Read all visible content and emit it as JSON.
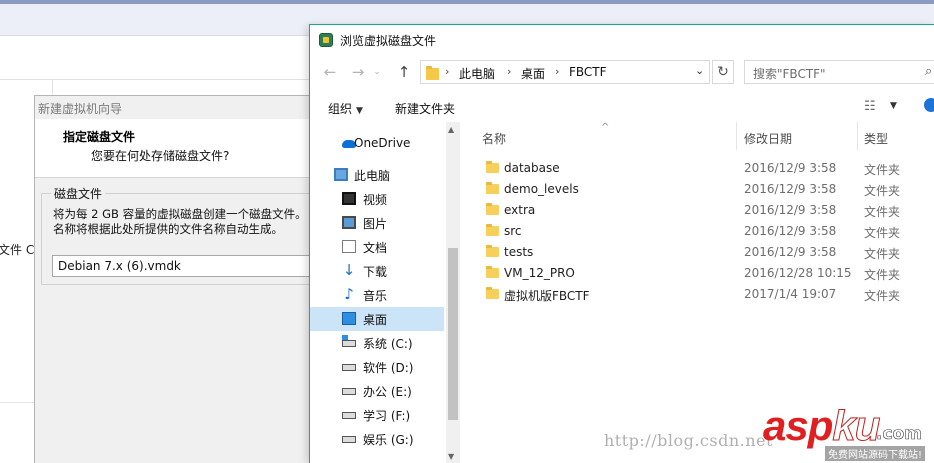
{
  "background": {
    "truncated_label": "文件 C:."
  },
  "wizard": {
    "title": "新建虚拟机向导",
    "heading": "指定磁盘文件",
    "subheading": "您要在何处存储磁盘文件?",
    "group_title": "磁盘文件",
    "description": "将为每 2 GB 容量的虚拟磁盘创建一个磁盘文件。\n名称将根据此处所提供的文件名称自动生成。",
    "filename": "Debian 7.x (6).vmdk"
  },
  "browser": {
    "title": "浏览虚拟磁盘文件",
    "breadcrumb": [
      "此电脑",
      "桌面",
      "FBCTF"
    ],
    "search_placeholder": "搜索\"FBCTF\"",
    "toolbar": {
      "organize_label": "组织",
      "new_folder_label": "新建文件夹"
    },
    "nav_items": [
      {
        "label": "OneDrive",
        "icon": "onedrive-icon"
      },
      {
        "label": "此电脑",
        "icon": "computer-icon"
      },
      {
        "label": "视频",
        "icon": "video-icon"
      },
      {
        "label": "图片",
        "icon": "pictures-icon"
      },
      {
        "label": "文档",
        "icon": "documents-icon"
      },
      {
        "label": "下载",
        "icon": "download-icon"
      },
      {
        "label": "音乐",
        "icon": "music-icon"
      },
      {
        "label": "桌面",
        "icon": "desktop-icon"
      },
      {
        "label": "系统 (C:)",
        "icon": "system-drive-icon"
      },
      {
        "label": "软件 (D:)",
        "icon": "drive-icon"
      },
      {
        "label": "办公 (E:)",
        "icon": "drive-icon"
      },
      {
        "label": "学习 (F:)",
        "icon": "drive-icon"
      },
      {
        "label": "娱乐 (G:)",
        "icon": "drive-icon"
      }
    ],
    "columns": {
      "name": "名称",
      "date": "修改日期",
      "type": "类型"
    },
    "files": [
      {
        "name": "database",
        "date": "2016/12/9 3:58",
        "type": "文件夹"
      },
      {
        "name": "demo_levels",
        "date": "2016/12/9 3:58",
        "type": "文件夹"
      },
      {
        "name": "extra",
        "date": "2016/12/9 3:58",
        "type": "文件夹"
      },
      {
        "name": "src",
        "date": "2016/12/9 3:58",
        "type": "文件夹"
      },
      {
        "name": "tests",
        "date": "2016/12/9 3:58",
        "type": "文件夹"
      },
      {
        "name": "VM_12_PRO",
        "date": "2016/12/28 10:15",
        "type": "文件夹"
      },
      {
        "name": "虚拟机版FBCTF",
        "date": "2017/1/4 19:07",
        "type": "文件夹"
      }
    ]
  },
  "watermark": {
    "url": "http://blog.csdn.net",
    "logo_main": "asp",
    "logo_ku": "ku",
    "logo_com": ".com",
    "tagline": "免费网站源码下载站!"
  }
}
